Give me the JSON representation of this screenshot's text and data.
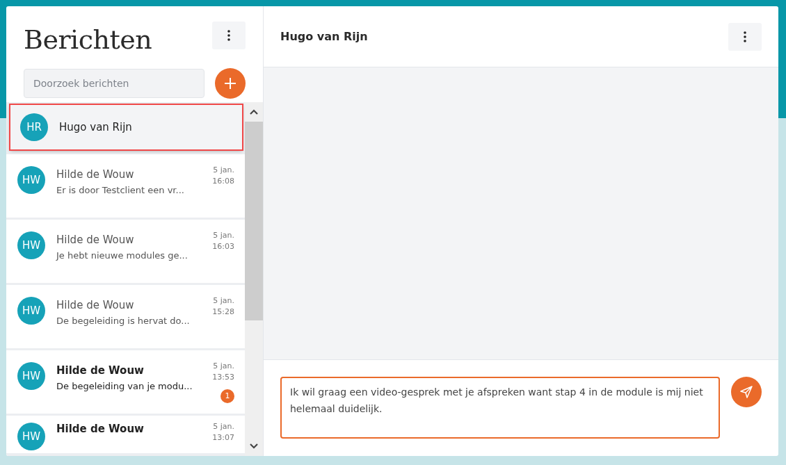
{
  "sidebar": {
    "title": "Berichten",
    "search": {
      "placeholder": "Doorzoek berichten"
    },
    "conversations": [
      {
        "initials": "HR",
        "name": "Hugo van Rijn",
        "selected": true,
        "unread": false
      },
      {
        "initials": "HW",
        "name": "Hilde de Wouw",
        "preview": "Er is door Testclient een vr...",
        "date": "5 jan.",
        "time": "16:08",
        "selected": false,
        "unread": false
      },
      {
        "initials": "HW",
        "name": "Hilde de Wouw",
        "preview": "Je hebt nieuwe modules ge...",
        "date": "5 jan.",
        "time": "16:03",
        "selected": false,
        "unread": false
      },
      {
        "initials": "HW",
        "name": "Hilde de Wouw",
        "preview": "De begeleiding is hervat do...",
        "date": "5 jan.",
        "time": "15:28",
        "selected": false,
        "unread": false
      },
      {
        "initials": "HW",
        "name": "Hilde de Wouw",
        "preview": "De begeleiding van je modu...",
        "date": "5 jan.",
        "time": "13:53",
        "badge": "1",
        "selected": false,
        "unread": true
      },
      {
        "initials": "HW",
        "name": "Hilde de Wouw",
        "date": "5 jan.",
        "time": "13:07",
        "selected": false,
        "unread": true
      }
    ]
  },
  "chat": {
    "title": "Hugo van Rijn",
    "composer": {
      "value": "Ik wil graag een video-gesprek met je afspreken want stap 4 in de module is mij niet helemaal duidelijk."
    }
  }
}
